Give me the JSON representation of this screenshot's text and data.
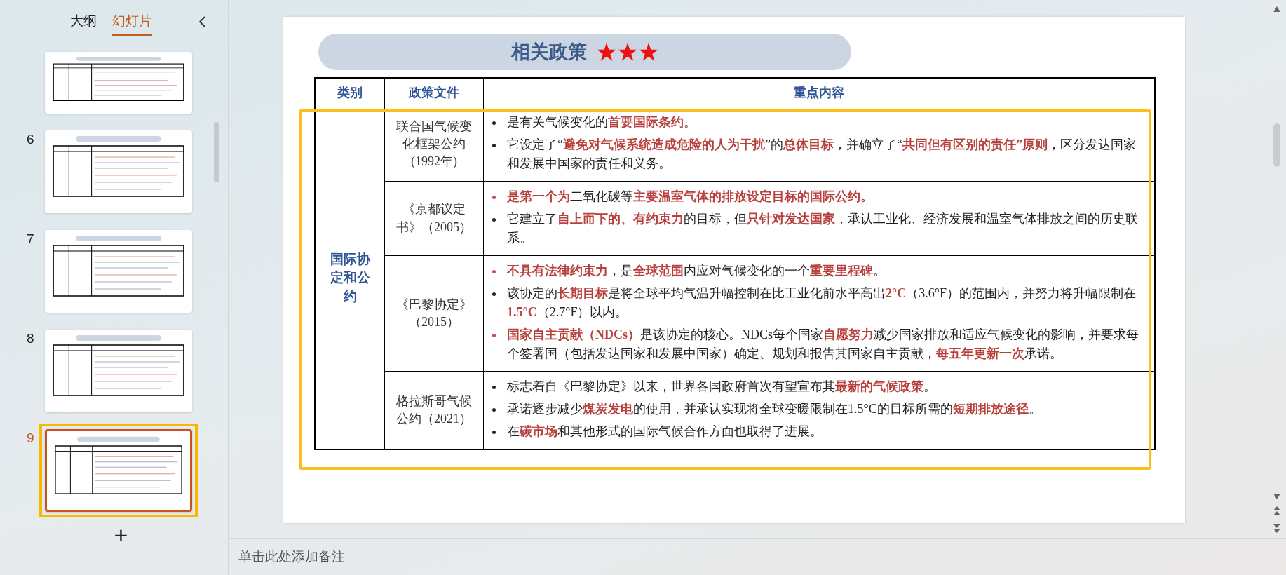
{
  "panel": {
    "tabs": [
      {
        "label": "大纲",
        "selected": false
      },
      {
        "label": "幻灯片",
        "selected": true
      }
    ]
  },
  "thumbnails": [
    {
      "selected": false,
      "cut": true
    },
    {
      "number": "6",
      "selected": false,
      "cut": false
    },
    {
      "number": "7",
      "selected": false,
      "cut": false
    },
    {
      "number": "8",
      "selected": false,
      "cut": false
    },
    {
      "number": "9",
      "selected": true,
      "cut": false
    }
  ],
  "add_slide": "+",
  "slide": {
    "title": "相关政策",
    "stars": 3,
    "annotation_frame": true,
    "table": {
      "columns": [
        "类别",
        "政策文件",
        "重点内容"
      ],
      "category": "国际协定和公约",
      "rows": [
        {
          "document": "联合国气候变化框架公约(1992年)",
          "bullets": [
            {
              "highlighted": false,
              "text": "是有关气候变化的**首要国际条约**。"
            },
            {
              "highlighted": false,
              "text": "它设定了“**避免对气候系统造成危险的人为干扰**”的**总体目标**，并确立了“**共同但有区别的责任”原则**，区分发达国家和发展中国家的责任和义务。"
            }
          ]
        },
        {
          "document": "《京都议定书》（2005）",
          "bullets": [
            {
              "highlighted": true,
              "text": "**是第一个为**二氧化碳等**主要温室气体的排放设定目标的国际公约。**"
            },
            {
              "highlighted": false,
              "text": "它建立了**自上而下的、有约束力**的目标，但**只针对发达国家**，承认工业化、经济发展和温室气体排放之间的历史联系。"
            }
          ]
        },
        {
          "document": "《巴黎协定》（2015）",
          "bullets": [
            {
              "highlighted": true,
              "text": "**不具有法律约束力**，是**全球范围**内应对气候变化的一个**重要里程碑**。"
            },
            {
              "highlighted": false,
              "text": "该协定的**长期目标**是将全球平均气温升幅控制在比工业化前水平高出**2°C**（3.6°F）的范围内，并努力将升幅限制在**1.5°C**（2.7°F）以内。"
            },
            {
              "highlighted": true,
              "text": "**国家自主贡献（NDCs）**是该协定的核心。NDCs每个国家**自愿努力**减少国家排放和适应气候变化的影响，并要求每个签署国（包括发达国家和发展中国家）确定、规划和报告其国家自主贡献，**每五年更新一次**承诺。"
            }
          ]
        },
        {
          "document": "格拉斯哥气候公约（2021）",
          "bullets": [
            {
              "highlighted": false,
              "text": "标志着自《巴黎协定》以来，世界各国政府首次有望宣布其**最新的气候政策**。"
            },
            {
              "highlighted": false,
              "text": "承诺逐步减少**煤炭发电**的使用，并承认实现将全球变暖限制在1.5°C的目标所需的**短期排放途径**。"
            },
            {
              "highlighted": false,
              "text": "在**碳市场**和其他形式的国际气候合作方面也取得了进展。"
            }
          ]
        }
      ]
    }
  },
  "notes": {
    "placeholder": "单击此处添加备注"
  }
}
